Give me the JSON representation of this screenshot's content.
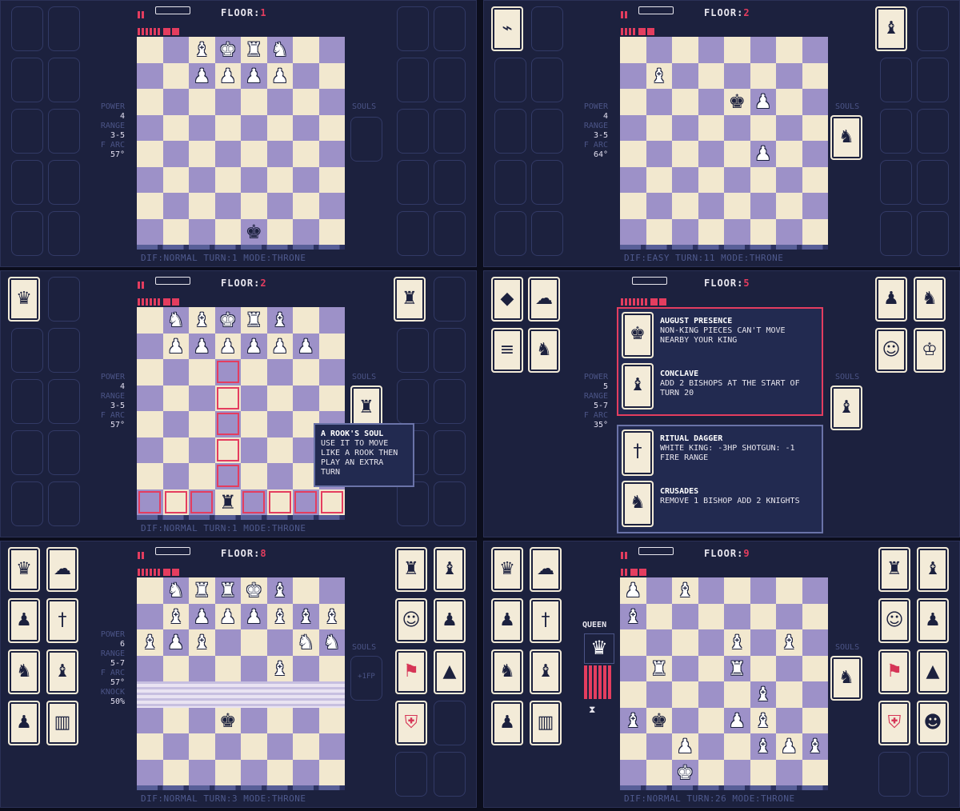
{
  "labels": {
    "floor": "FLOOR:",
    "power": "POWER",
    "range": "RANGE",
    "arc": "F ARC",
    "knock": "KNOCK",
    "souls": "SOULS",
    "queen": "QUEEN"
  },
  "panels": [
    {
      "floor": "1",
      "power": "4",
      "range": "3-5",
      "arc": "57°",
      "status": "DIF:NORMAL  TURN:1  MODE:THRONE"
    },
    {
      "floor": "2",
      "power": "4",
      "range": "3-5",
      "arc": "64°",
      "status": "DIF:EASY  TURN:11  MODE:THRONE"
    },
    {
      "floor": "2",
      "power": "4",
      "range": "3-5",
      "arc": "57°",
      "status": "DIF:NORMAL  TURN:1  MODE:THRONE"
    },
    {
      "floor": "5",
      "power": "5",
      "range": "5-7",
      "arc": "35°",
      "status": ""
    },
    {
      "floor": "8",
      "power": "6",
      "range": "5-7",
      "arc": "57°",
      "knock": "50%",
      "souls_cost": "+1FP",
      "status": "DIF:NORMAL  TURN:3  MODE:THRONE"
    },
    {
      "floor": "9",
      "status": "DIF:NORMAL  TURN:26  MODE:THRONE"
    }
  ],
  "tooltip_rook": {
    "title": "A ROOK'S SOUL",
    "body": "USE IT TO MOVE LIKE A ROOK THEN PLAY AN EXTRA TURN"
  },
  "cards_panel4": [
    {
      "title": "AUGUST PRESENCE",
      "body": "NON-KING PIECES CAN'T MOVE NEARBY YOUR KING"
    },
    {
      "title": "CONCLAVE",
      "body": "ADD 2 BISHOPS AT THE START OF TURN 20"
    },
    {
      "title": "RITUAL DAGGER",
      "body": "WHITE KING: -3HP SHOTGUN: -1 FIRE RANGE"
    },
    {
      "title": "CRUSADES",
      "body": "REMOVE 1 BISHOP ADD 2 KNIGHTS"
    }
  ],
  "colors": {
    "bg": "#1c213e",
    "light": "#f2e8cf",
    "dark": "#9d91c8",
    "accent": "#e43d5f"
  }
}
